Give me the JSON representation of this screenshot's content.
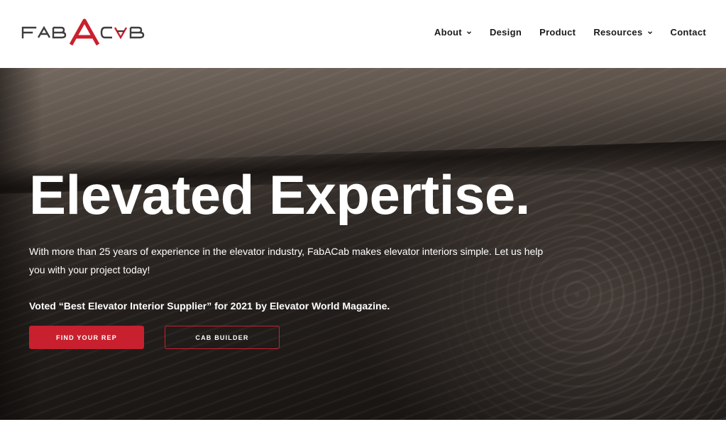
{
  "header": {
    "logo": {
      "text": "FABACAB",
      "primary_color": "#3d3d3d",
      "accent_color": "#c8202e"
    },
    "nav": [
      {
        "label": "About",
        "has_dropdown": true
      },
      {
        "label": "Design",
        "has_dropdown": false
      },
      {
        "label": "Product",
        "has_dropdown": false
      },
      {
        "label": "Resources",
        "has_dropdown": true
      },
      {
        "label": "Contact",
        "has_dropdown": false
      }
    ]
  },
  "hero": {
    "title": "Elevated Expertise.",
    "description": "With more than 25 years of experience in the elevator industry, FabACab makes elevator interiors simple. Let us help you with your project today!",
    "award": "Voted “Best Elevator Interior Supplier” for 2021 by Elevator World Magazine.",
    "primary_button": "FIND YOUR REP",
    "secondary_button": "CAB BUILDER"
  },
  "colors": {
    "brand_red": "#c8202e",
    "nav_text": "#1a1a1a",
    "hero_text": "#ffffff"
  }
}
